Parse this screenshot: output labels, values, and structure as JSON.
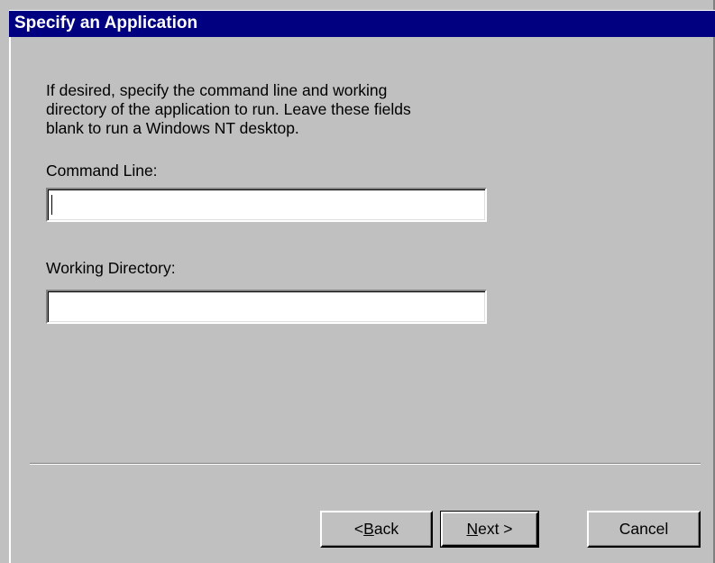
{
  "dialog": {
    "title": "Specify an Application",
    "description": "If desired, specify the command line and working directory of the application to run. Leave these fields blank to run a Windows NT desktop.",
    "command_line": {
      "label": "Command Line:",
      "value": ""
    },
    "working_directory": {
      "label": "Working Directory:",
      "value": ""
    },
    "buttons": {
      "back": {
        "prefix": "< ",
        "accel": "B",
        "rest": "ack"
      },
      "next": {
        "accel": "N",
        "rest": "ext >"
      },
      "cancel": "Cancel"
    }
  },
  "colors": {
    "title_bar": "#000080",
    "face": "#c0c0c0",
    "field": "#ffffff"
  }
}
